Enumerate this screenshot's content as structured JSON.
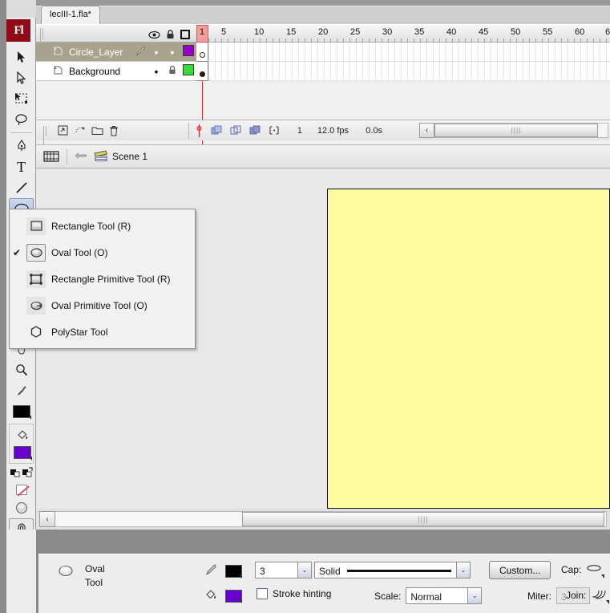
{
  "app": {
    "logo_text": "Fl"
  },
  "document_tab": {
    "title": "lecIII-1.fla*"
  },
  "timeline": {
    "header_icons": [
      "eye-icon",
      "lock-icon",
      "outline-square-icon"
    ],
    "layers": [
      {
        "name": "Circle_Layer",
        "active": true,
        "visible_dot": "•",
        "lock_state": "•",
        "color": "#9900cc",
        "pencil": true,
        "keyframe": "hollow"
      },
      {
        "name": "Background",
        "active": false,
        "visible_dot": "•",
        "lock_state": "locked",
        "color": "#33dd33",
        "pencil": false,
        "keyframe": "filled"
      }
    ],
    "ruler_labels": [
      "1",
      "5",
      "10",
      "15",
      "20",
      "25",
      "30",
      "35",
      "40",
      "45",
      "50",
      "55",
      "60",
      "6"
    ],
    "ruler_positions": [
      3,
      42,
      78,
      120,
      161,
      201,
      241,
      281,
      321,
      361,
      401,
      441,
      481,
      515
    ],
    "playhead_frame": 1,
    "bottom_tools": [
      "new-layer-icon",
      "add-motion-guide-icon",
      "new-folder-icon",
      "delete-layer-icon"
    ],
    "frame_tools": [
      "center-frame-icon",
      "onion-skin-icon",
      "onion-skin-outlines-icon",
      "edit-multiple-frames-icon",
      "modify-onion-markers-icon"
    ],
    "status": {
      "current_frame": "1",
      "fps": "12.0 fps",
      "elapsed": "0.0s"
    },
    "scroll_left_arrow": "‹"
  },
  "scene_bar": {
    "edit_symbols_icon": "edit-scene-icon",
    "back_arrow": "←",
    "scene_icon": "clapperboard-icon",
    "scene_label": "Scene 1"
  },
  "stage": {
    "background_color": "#fffba0"
  },
  "stage_scroll": {
    "left_arrow": "‹"
  },
  "tools": {
    "items": [
      {
        "name": "selection-tool",
        "selected": false
      },
      {
        "name": "subselection-tool",
        "selected": false
      },
      {
        "name": "free-transform-tool",
        "selected": false
      },
      {
        "name": "lasso-tool",
        "selected": false
      },
      {
        "name": "pen-tool",
        "selected": false
      },
      {
        "name": "text-tool",
        "selected": false
      },
      {
        "name": "line-tool",
        "selected": false
      },
      {
        "name": "oval-tool",
        "selected": true
      },
      {
        "name": "hand-tool",
        "selected": false
      },
      {
        "name": "zoom-tool",
        "selected": false
      },
      {
        "name": "eyedropper-tool",
        "selected": false
      }
    ],
    "stroke_color": "#000000",
    "fill_color": "#6600cc",
    "options": [
      "black-and-white-icon",
      "swap-colors-icon",
      "no-color-icon",
      "smooth-icon",
      "snap-to-objects-icon"
    ]
  },
  "tool_menu": {
    "items": [
      {
        "label": "Rectangle Tool (R)",
        "icon": "rectangle-icon",
        "checked": false
      },
      {
        "label": "Oval Tool (O)",
        "icon": "oval-icon",
        "checked": true
      },
      {
        "label": "Rectangle Primitive Tool (R)",
        "icon": "rectangle-primitive-icon",
        "checked": false
      },
      {
        "label": "Oval Primitive Tool (O)",
        "icon": "oval-primitive-icon",
        "checked": false
      },
      {
        "label": "PolyStar Tool",
        "icon": "polystar-icon",
        "checked": false
      }
    ],
    "check_glyph": "✔"
  },
  "properties": {
    "tool_icon": "oval-tool-icon",
    "tool_name_line1": "Oval",
    "tool_name_line2": "Tool",
    "stroke_icon": "pencil-icon",
    "stroke_color": "#000000",
    "fill_icon": "paint-bucket-icon",
    "fill_color": "#6600cc",
    "stroke_width": "3",
    "stroke_style": "Solid",
    "custom_button": "Custom...",
    "cap_label": "Cap:",
    "stroke_hinting_label": "Stroke hinting",
    "stroke_hinting_checked": false,
    "scale_label": "Scale:",
    "scale_value": "Normal",
    "miter_label": "Miter:",
    "miter_value": "3",
    "join_label": "Join:",
    "dropdown_glyph": "⌄"
  }
}
